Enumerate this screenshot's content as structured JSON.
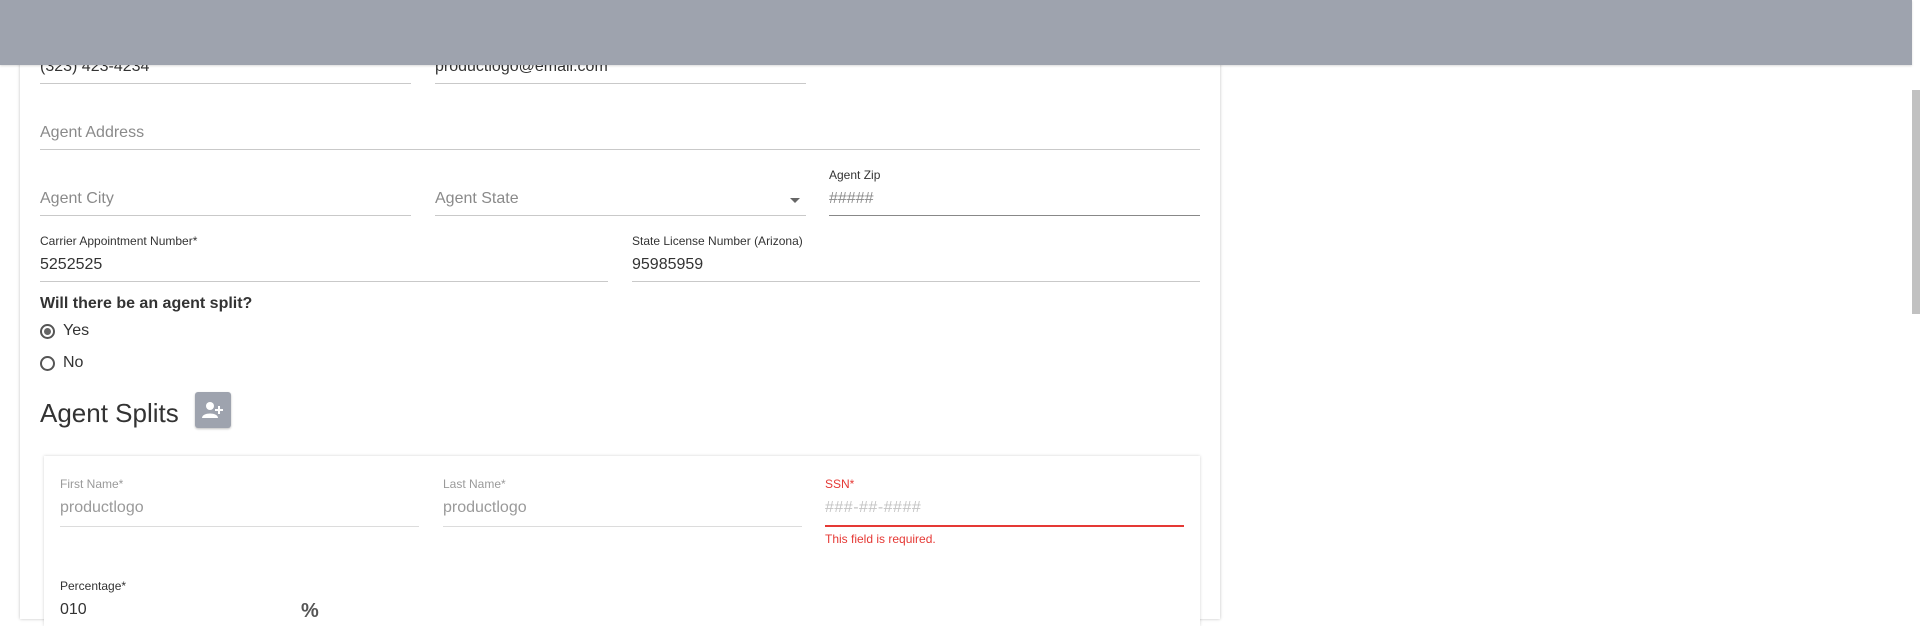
{
  "contact": {
    "phone_value": "(323) 423-4234",
    "email_value": "productlogo@email.com"
  },
  "address": {
    "placeholder": "Agent Address"
  },
  "city": {
    "placeholder": "Agent City"
  },
  "state": {
    "placeholder": "Agent State"
  },
  "zip": {
    "label": "Agent Zip",
    "placeholder": "#####"
  },
  "carrier": {
    "label": "Carrier Appointment Number*",
    "value": "5252525"
  },
  "license": {
    "label": "State License Number (Arizona)",
    "value": "95985959"
  },
  "agent_split": {
    "question": "Will there be an agent split?",
    "options": [
      {
        "label": "Yes",
        "selected": true
      },
      {
        "label": "No",
        "selected": false
      }
    ]
  },
  "agent_splits": {
    "title": "Agent Splits",
    "add_icon": "person-add-icon",
    "first_name": {
      "label": "First Name*",
      "value": "productlogo"
    },
    "last_name": {
      "label": "Last Name*",
      "value": "productlogo"
    },
    "ssn": {
      "label": "SSN*",
      "placeholder": "###-##-####",
      "error": "This field is required."
    },
    "percentage": {
      "label": "Percentage*",
      "value": "010",
      "unit": "%"
    }
  },
  "colors": {
    "topbar": "#9ea3ae",
    "error": "#e53935",
    "add_button": "#9ea3ae"
  }
}
